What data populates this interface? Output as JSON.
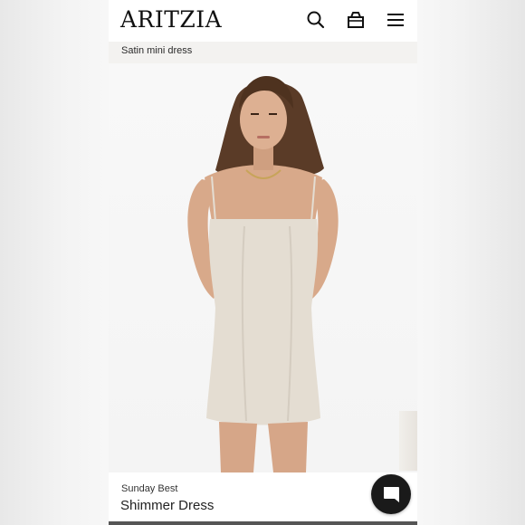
{
  "header": {
    "logo": "ARITZIA",
    "icons": [
      "search-icon",
      "bag-icon",
      "menu-icon"
    ]
  },
  "subbar": {
    "text": "Satin mini dress"
  },
  "product": {
    "brand": "Sunday Best",
    "name": "Shimmer Dress"
  },
  "colors": {
    "dress": "#e4ddd2",
    "skin": "#d8a98a",
    "hair": "#5a3b27",
    "chat_button": "#1a1a1a"
  }
}
